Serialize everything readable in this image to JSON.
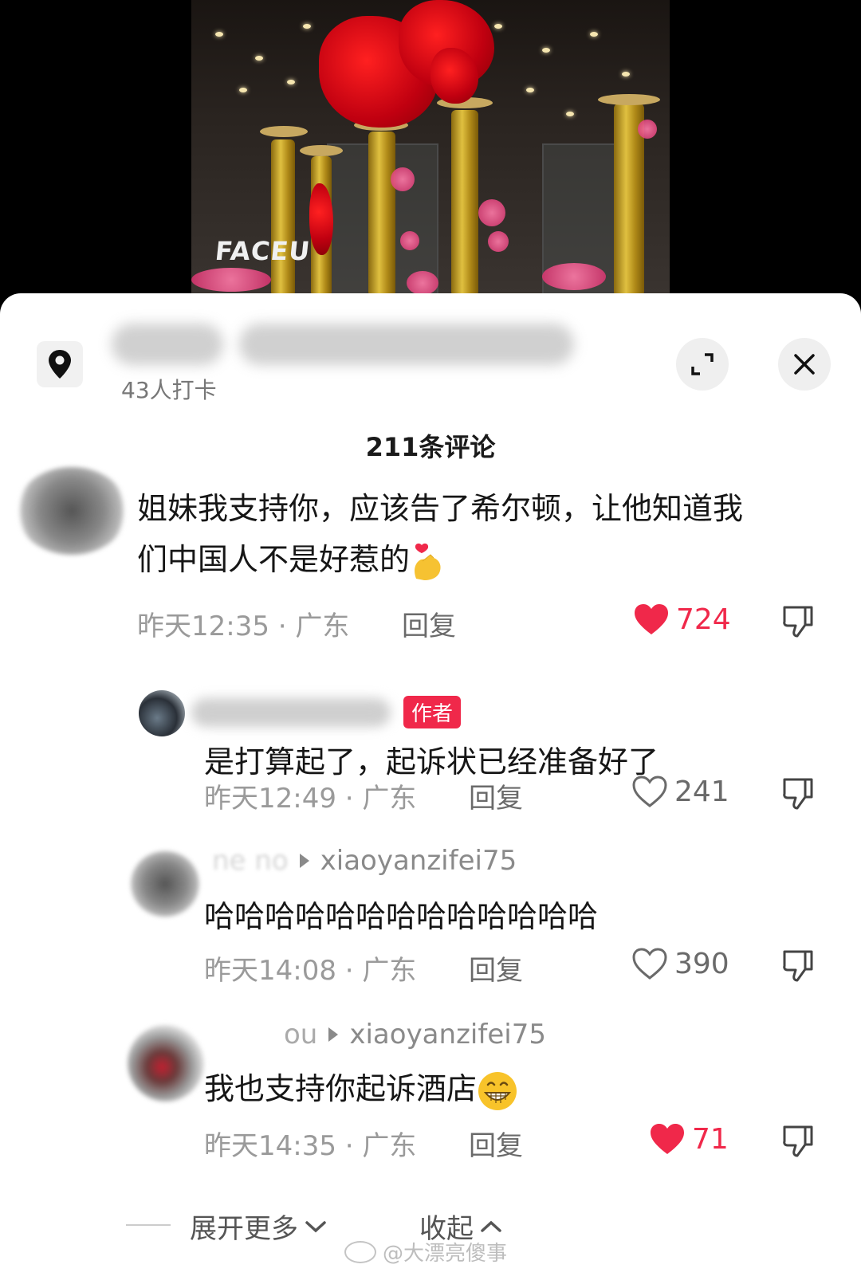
{
  "video": {
    "sign_text": "FACEU"
  },
  "header": {
    "checkin_count": "43人打卡",
    "location_icon": "location-pin-icon",
    "expand_icon": "expand-icon",
    "close_icon": "close-icon"
  },
  "comments_title": "211条评论",
  "comments": [
    {
      "text_line1": "姐妹我支持你，应该告了希尔顿，让他知道我",
      "text_line2": "们中国人不是好惹的",
      "time": "昨天12:35 · 广东",
      "reply_label": "回复",
      "likes": "724",
      "liked": true
    },
    {
      "tag": "作者",
      "text": "是打算起了，起诉状已经准备好了",
      "time": "昨天12:49 · 广东",
      "reply_label": "回复",
      "likes": "241",
      "liked": false
    },
    {
      "reply_to": "xiaoyanzifei75",
      "name_fragment": "ne   no",
      "text": "哈哈哈哈哈哈哈哈哈哈哈哈哈",
      "time": "昨天14:08 · 广东",
      "reply_label": "回复",
      "likes": "390",
      "liked": false
    },
    {
      "reply_to": "xiaoyanzifei75",
      "name_fragment": "ou",
      "text": "我也支持你起诉酒店",
      "time": "昨天14:35 · 广东",
      "reply_label": "回复",
      "likes": "71",
      "liked": true
    }
  ],
  "footer": {
    "expand_more": "展开更多",
    "collapse": "收起",
    "watermark": "@大漂亮傻事"
  },
  "colors": {
    "accent_red": "#f0284a",
    "text_primary": "#161616",
    "text_meta": "#9a9a9a"
  }
}
